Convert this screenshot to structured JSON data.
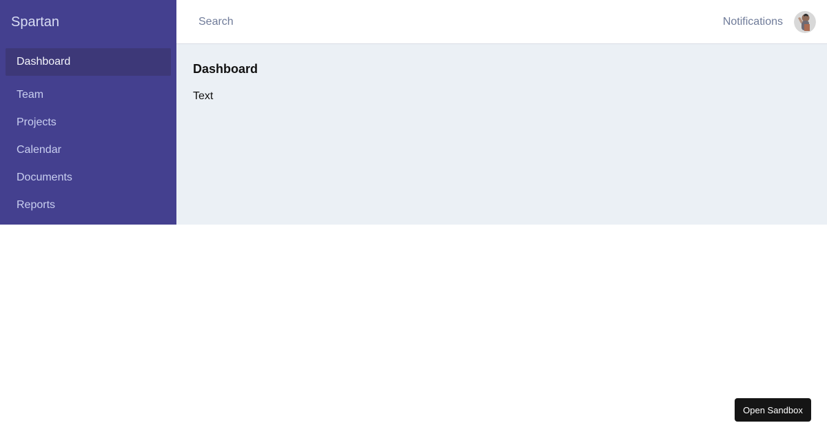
{
  "sidebar": {
    "brand": "Spartan",
    "items": [
      {
        "label": "Dashboard",
        "active": true
      },
      {
        "label": "Team"
      },
      {
        "label": "Projects"
      },
      {
        "label": "Calendar"
      },
      {
        "label": "Documents"
      },
      {
        "label": "Reports"
      }
    ]
  },
  "header": {
    "search_placeholder": "Search",
    "notifications_label": "Notifications",
    "avatar_icon": "user-avatar-icon"
  },
  "main": {
    "title": "Dashboard",
    "text": "Text"
  },
  "sandbox": {
    "button_label": "Open Sandbox"
  },
  "colors": {
    "sidebar_bg": "#44408f",
    "sidebar_active": "#3d3878",
    "main_bg": "#ebf0f5",
    "button_bg": "#151515"
  }
}
